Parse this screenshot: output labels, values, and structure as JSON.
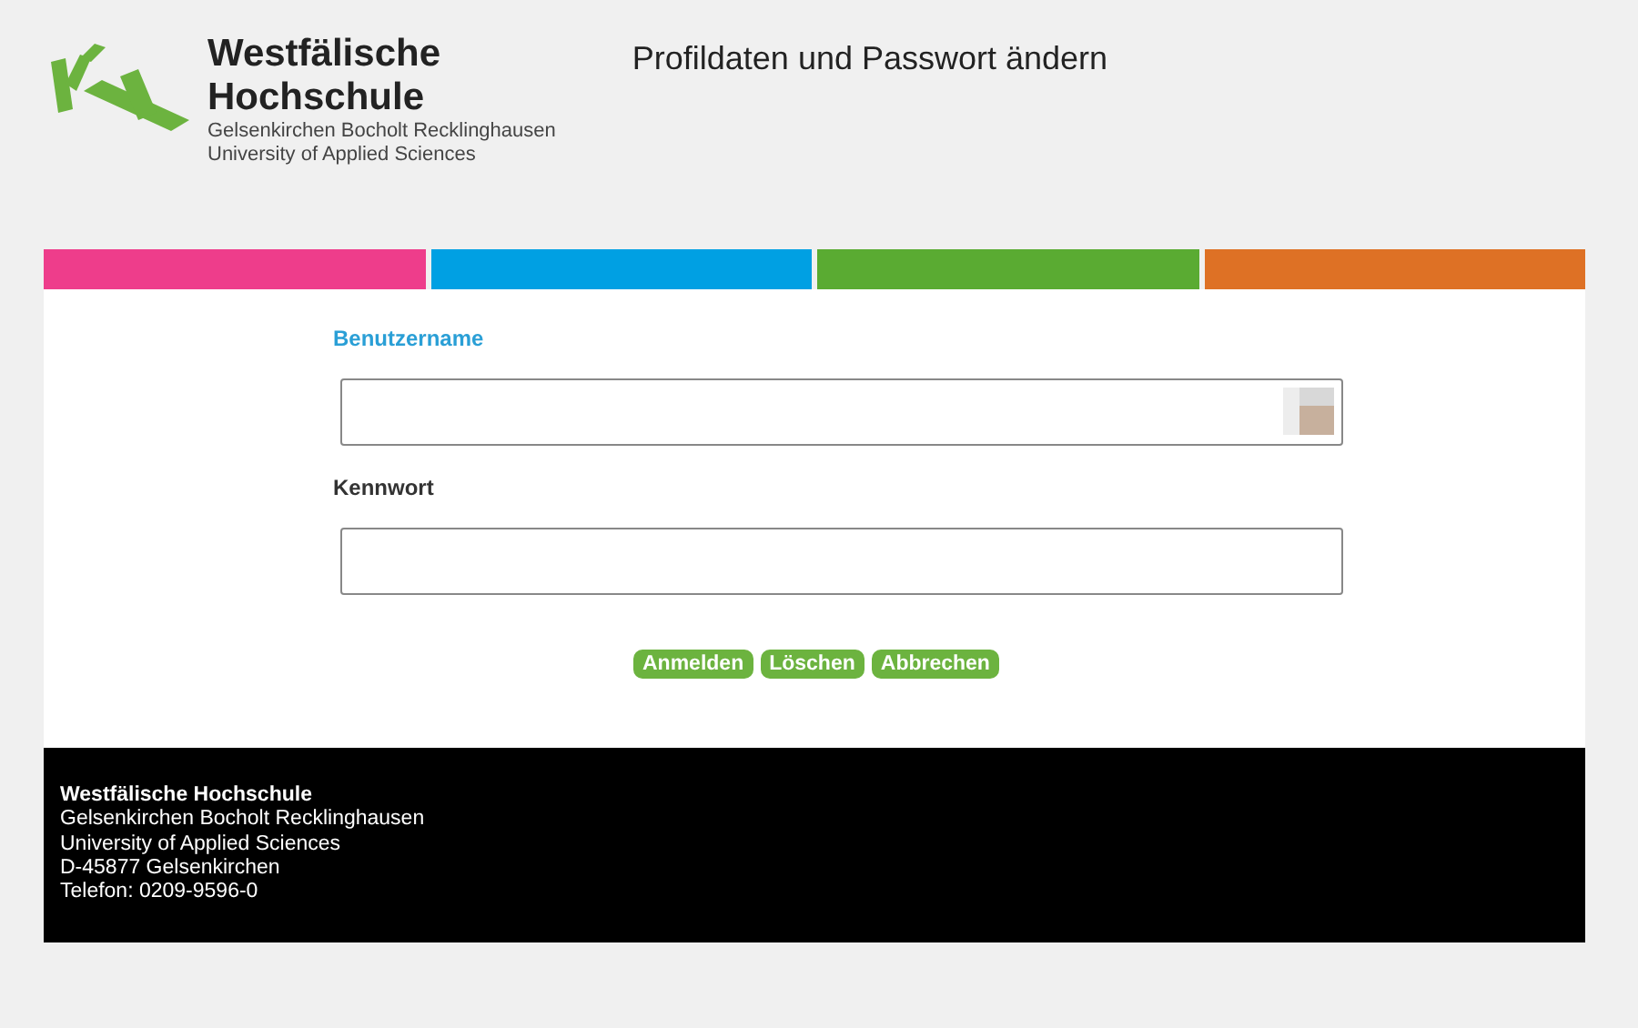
{
  "logo": {
    "name": "Westfälische",
    "name_2": "Hochschule",
    "locations": "Gelsenkirchen Bocholt Recklinghausen",
    "subtitle": "University of Applied Sciences"
  },
  "page_title": "Profildaten und Passwort ändern",
  "color_stripes": [
    {
      "color": "#ee3d8b"
    },
    {
      "color": "#00a0e3"
    },
    {
      "color": "#5aab32"
    },
    {
      "color": "#de7125"
    }
  ],
  "form": {
    "fields": [
      {
        "label": "Benutzername",
        "highlighted": true,
        "kind": "text"
      },
      {
        "label": "Kennwort",
        "highlighted": false,
        "kind": "password"
      }
    ],
    "buttons": [
      "Anmelden",
      "Löschen",
      "Abbrechen"
    ]
  },
  "footer": {
    "lines": [
      "Westfälische Hochschule",
      "Gelsenkirchen Bocholt Recklinghausen",
      "University of Applied Sciences",
      "D-45877 Gelsenkirchen",
      "Telefon: 0209-9596-0"
    ]
  }
}
